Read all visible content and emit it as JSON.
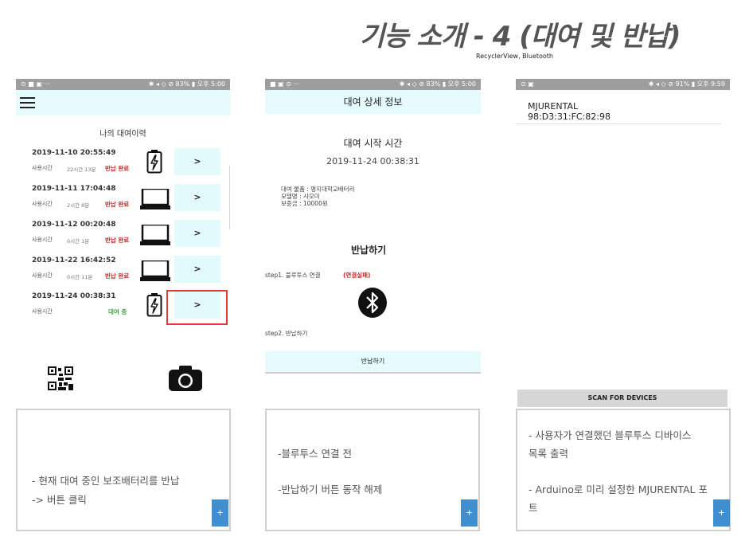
{
  "header": {
    "title": "기능 소개 - 4 (대여 및 반납)",
    "subtitle": "RecyclerView, Bluetooth"
  },
  "screen1": {
    "status_left": "⊙ ■ ▣ ···",
    "status_right": "✱ ◂ ◇ ⊘ 83% ▮ 오후 5:00",
    "list_title": "나의 대여이력",
    "rows": [
      {
        "date": "2019-11-10 20:55:49",
        "label": "사용시간",
        "duration": "22시간 13분",
        "status": "반납 완료",
        "device": "battery",
        "button": ">"
      },
      {
        "date": "2019-11-11 17:04:48",
        "label": "사용시간",
        "duration": "2시간 8분",
        "status": "반납 완료",
        "device": "laptop",
        "button": ">"
      },
      {
        "date": "2019-11-12 00:20:48",
        "label": "사용시간",
        "duration": "0시간 1분",
        "status": "반납 완료",
        "device": "laptop",
        "button": ">"
      },
      {
        "date": "2019-11-22 16:42:52",
        "label": "사용시간",
        "duration": "0시간 11분",
        "status": "반납 완료",
        "device": "laptop",
        "button": ">"
      },
      {
        "date": "2019-11-24 00:38:31",
        "label": "사용시간",
        "duration": "",
        "status": "대여 중",
        "device": "battery",
        "button": ">"
      }
    ],
    "description": [
      "- 현재 대여 중인 보조배터리를 반납",
      "-> 버튼 클릭"
    ],
    "fab": "+"
  },
  "screen2": {
    "status_left": "■ ▣ ⊙ ···",
    "status_right": "✱ ◂ ◇ ⊘ 83% ▮ 오후 5:00",
    "header": "대여 상세 정보",
    "start_heading": "대여 시작 시간",
    "start_time": "2019-11-24 00:38:31",
    "item": "대여 물품 : 명지대학교배터리",
    "model": "모델명 : 샤오미",
    "deposit": "보증금 : 10000원",
    "return_heading": "반납하기",
    "step1": "step1. 블루투스 연결",
    "step1_status": "(연결실패)",
    "step2": "step2. 반납하기",
    "return_button": "반납하기",
    "description": [
      "-블루투스 연결 전",
      "-반납하기 버튼 동작 해제"
    ],
    "fab": "+"
  },
  "screen3": {
    "status_left": "⊙ ▣",
    "status_right": "✱ ◂ ◇ ⊘ 91% ▮ 오후 9:59",
    "device_name": "MJURENTAL",
    "device_addr": "98:D3:31:FC:82:98",
    "scan_button": "SCAN FOR DEVICES",
    "description": [
      "- 사용자가 연결했던 블루투스 디바이스",
      "목록 출력",
      "- Arduino로 미리 설정한 MJURENTAL 포",
      "트"
    ],
    "fab": "+"
  },
  "colors": {
    "accent_cyan": "#e6fbfd",
    "status_done": "#c62828",
    "status_renting": "#43a047",
    "fab_blue": "#3f8fd0",
    "highlight_red": "#e53935"
  }
}
